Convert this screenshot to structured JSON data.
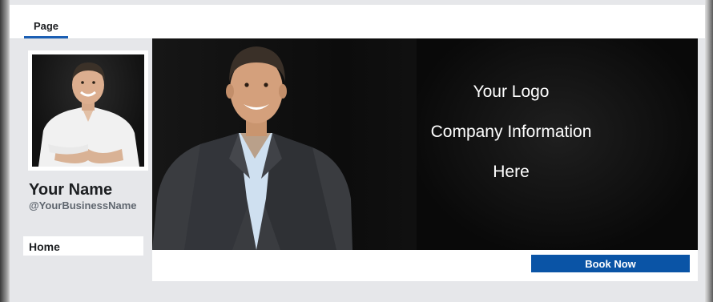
{
  "tabs": [
    {
      "label": "Page",
      "active": true
    }
  ],
  "profile": {
    "name": "Your Name",
    "handle": "@YourBusinessName"
  },
  "nav": {
    "home_label": "Home"
  },
  "cover": {
    "lines": [
      "Your Logo",
      "Company Information",
      "Here"
    ]
  },
  "actions": {
    "book_label": "Book Now"
  },
  "colors": {
    "accent_blue": "#0a54a6",
    "tab_underline": "#1b5fb4",
    "page_bg": "#e6e7ea",
    "cover_bg": "#0c0c0c"
  }
}
